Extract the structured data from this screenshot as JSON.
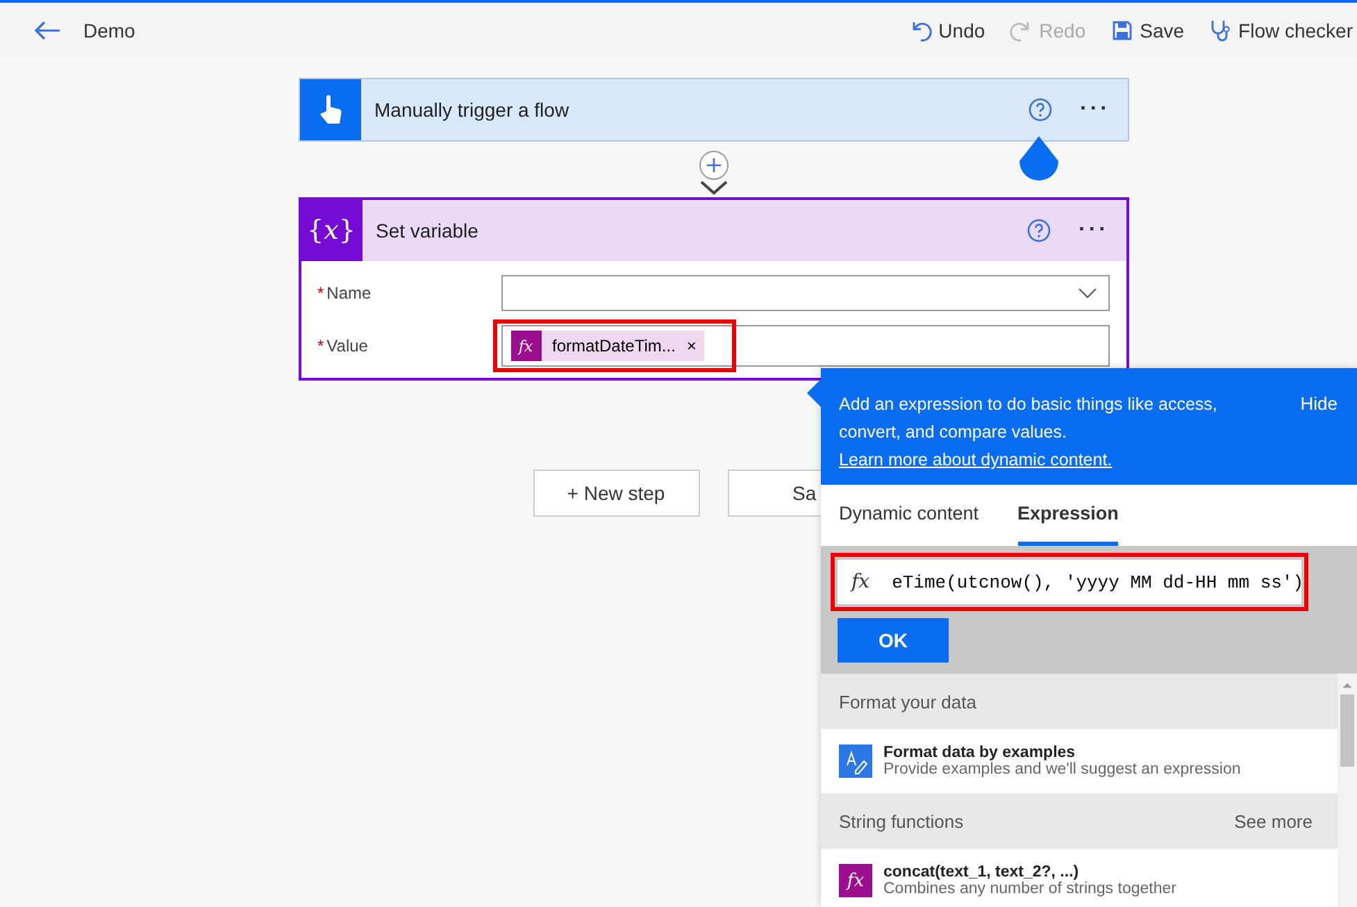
{
  "header": {
    "title": "Demo",
    "actions": [
      {
        "kind": "undo",
        "label": "Undo",
        "disabled": false
      },
      {
        "kind": "redo",
        "label": "Redo",
        "disabled": true
      },
      {
        "kind": "save",
        "label": "Save",
        "disabled": false
      },
      {
        "kind": "checker",
        "label": "Flow checker",
        "disabled": false
      }
    ]
  },
  "trigger": {
    "title": "Manually trigger a flow",
    "more": "···"
  },
  "action": {
    "icon": "{𝑥}",
    "title": "Set variable",
    "more": "···",
    "fields": [
      {
        "label": "Name",
        "required": "*",
        "kind": "dropdown"
      },
      {
        "label": "Value",
        "required": "*",
        "kind": "token",
        "token": {
          "symbol": "fx",
          "text": "formatDateTim...",
          "remove": "×"
        }
      }
    ]
  },
  "buttons": [
    {
      "label": "+ New step"
    },
    {
      "label": "Sa"
    }
  ],
  "popup": {
    "intro": "Add an expression to do basic things like access, convert, and compare values. ",
    "link": "Learn more about dynamic content.",
    "hide": "Hide",
    "tabs": [
      {
        "label": "Dynamic content",
        "selected": false
      },
      {
        "label": "Expression",
        "selected": true
      }
    ],
    "expression": {
      "symbol": "fx",
      "value": "eTime(utcnow(), 'yyyy MM dd-HH mm ss')"
    },
    "ok": "OK",
    "sections": [
      {
        "title": "Format your data",
        "items": [
          {
            "kind": "format",
            "title": "Format data by examples",
            "description": "Provide examples and we'll suggest an expression"
          }
        ]
      },
      {
        "title": "String functions",
        "more": "See more",
        "items": [
          {
            "kind": "function",
            "symbol": "fx",
            "title": "concat(text_1, text_2?, ...)",
            "description": "Combines any number of strings together"
          }
        ]
      }
    ]
  }
}
